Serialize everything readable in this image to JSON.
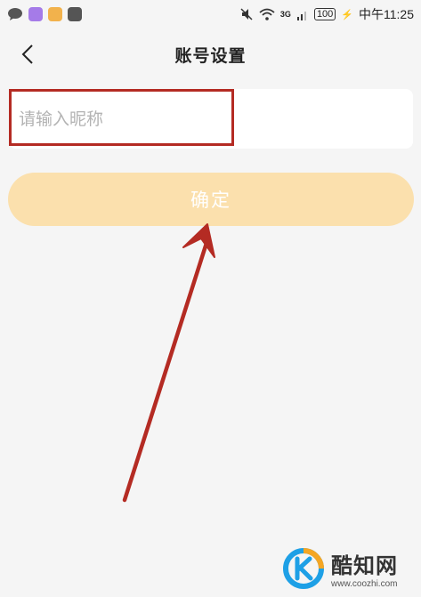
{
  "status_bar": {
    "battery": "100",
    "network": "3G",
    "time": "中午11:25"
  },
  "header": {
    "title": "账号设置"
  },
  "form": {
    "nickname_placeholder": "请输入昵称",
    "confirm_label": "确定"
  },
  "watermark": {
    "brand": "酷知网",
    "url": "www.coozhi.com"
  },
  "colors": {
    "button_bg": "#fbe0ad",
    "highlight_red": "#b42b23",
    "page_bg": "#f5f5f5"
  }
}
